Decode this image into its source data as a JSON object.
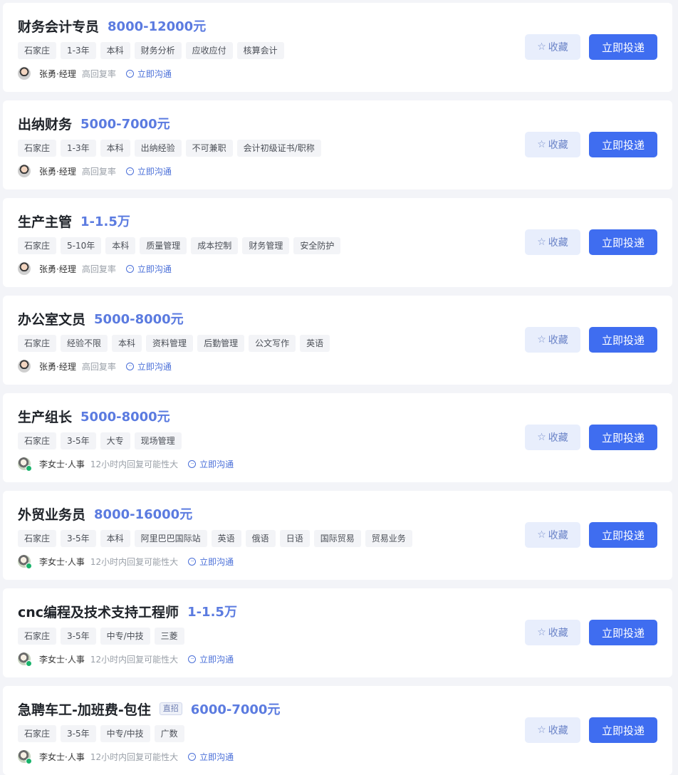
{
  "actions": {
    "favorite_label": "收藏",
    "apply_label": "立即投递",
    "chat_label": "立即沟通"
  },
  "jobs": [
    {
      "title": "财务会计专员",
      "badge": "",
      "salary": "8000-12000元",
      "tags": [
        "石家庄",
        "1-3年",
        "本科",
        "财务分析",
        "应收应付",
        "核算会计"
      ],
      "hr": {
        "name": "张勇·经理",
        "status": "高回复率",
        "avatar": "male-avatar",
        "online": false
      }
    },
    {
      "title": "出纳财务",
      "badge": "",
      "salary": "5000-7000元",
      "tags": [
        "石家庄",
        "1-3年",
        "本科",
        "出纳经验",
        "不可兼职",
        "会计初级证书/职称"
      ],
      "hr": {
        "name": "张勇·经理",
        "status": "高回复率",
        "avatar": "male-avatar",
        "online": false
      }
    },
    {
      "title": "生产主管",
      "badge": "",
      "salary": "1-1.5万",
      "tags": [
        "石家庄",
        "5-10年",
        "本科",
        "质量管理",
        "成本控制",
        "财务管理",
        "安全防护"
      ],
      "hr": {
        "name": "张勇·经理",
        "status": "高回复率",
        "avatar": "male-avatar",
        "online": false
      }
    },
    {
      "title": "办公室文员",
      "badge": "",
      "salary": "5000-8000元",
      "tags": [
        "石家庄",
        "经验不限",
        "本科",
        "资料管理",
        "后勤管理",
        "公文写作",
        "英语"
      ],
      "hr": {
        "name": "张勇·经理",
        "status": "高回复率",
        "avatar": "male-avatar",
        "online": false
      }
    },
    {
      "title": "生产组长",
      "badge": "",
      "salary": "5000-8000元",
      "tags": [
        "石家庄",
        "3-5年",
        "大专",
        "现场管理"
      ],
      "hr": {
        "name": "李女士·人事",
        "status": "12小时内回复可能性大",
        "avatar": "female-avatar",
        "online": true
      }
    },
    {
      "title": "外贸业务员",
      "badge": "",
      "salary": "8000-16000元",
      "tags": [
        "石家庄",
        "3-5年",
        "本科",
        "阿里巴巴国际站",
        "英语",
        "俄语",
        "日语",
        "国际贸易",
        "贸易业务"
      ],
      "hr": {
        "name": "李女士·人事",
        "status": "12小时内回复可能性大",
        "avatar": "female-avatar",
        "online": true
      }
    },
    {
      "title": "cnc编程及技术支持工程师",
      "badge": "",
      "salary": "1-1.5万",
      "tags": [
        "石家庄",
        "3-5年",
        "中专/中技",
        "三菱"
      ],
      "hr": {
        "name": "李女士·人事",
        "status": "12小时内回复可能性大",
        "avatar": "female-avatar",
        "online": true
      }
    },
    {
      "title": "急聘车工-加班费-包住",
      "badge": "直招",
      "salary": "6000-7000元",
      "tags": [
        "石家庄",
        "3-5年",
        "中专/中技",
        "广数"
      ],
      "hr": {
        "name": "李女士·人事",
        "status": "12小时内回复可能性大",
        "avatar": "female-avatar",
        "online": true
      }
    }
  ]
}
